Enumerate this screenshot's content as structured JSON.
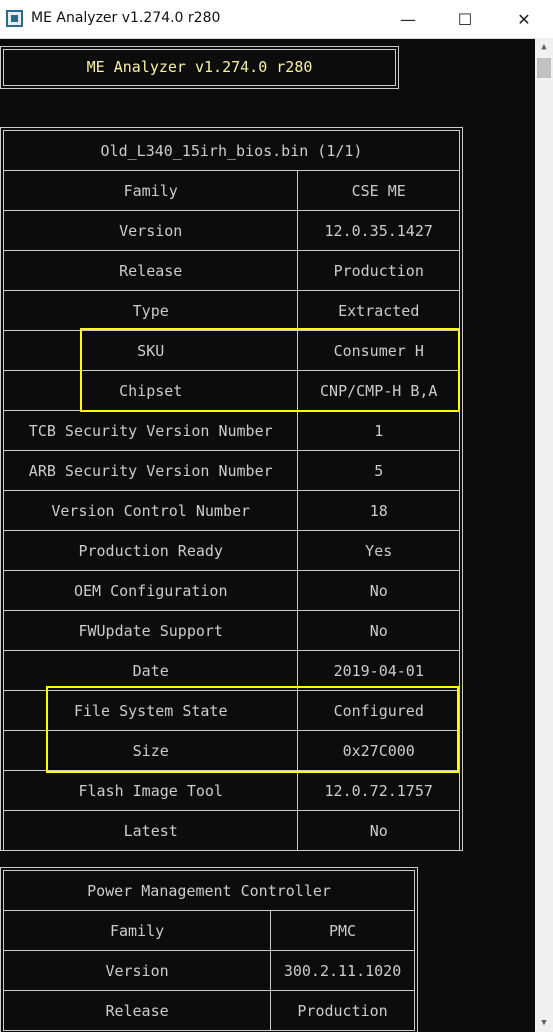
{
  "window": {
    "title": "ME Analyzer v1.274.0 r280",
    "app_icon": "app-icon",
    "controls": {
      "minimize": "—",
      "maximize": "☐",
      "close": "✕"
    }
  },
  "header": {
    "text": "ME Analyzer v1.274.0 r280"
  },
  "me_table": {
    "caption": "Old_L340_15irh_bios.bin (1/1)",
    "rows": [
      {
        "label": "Family",
        "value": "CSE ME"
      },
      {
        "label": "Version",
        "value": "12.0.35.1427"
      },
      {
        "label": "Release",
        "value": "Production"
      },
      {
        "label": "Type",
        "value": "Extracted"
      },
      {
        "label": "SKU",
        "value": "Consumer H"
      },
      {
        "label": "Chipset",
        "value": "CNP/CMP-H B,A"
      },
      {
        "label": "TCB Security Version Number",
        "value": "1"
      },
      {
        "label": "ARB Security Version Number",
        "value": "5"
      },
      {
        "label": "Version Control Number",
        "value": "18"
      },
      {
        "label": "Production Ready",
        "value": "Yes"
      },
      {
        "label": "OEM Configuration",
        "value": "No"
      },
      {
        "label": "FWUpdate Support",
        "value": "No"
      },
      {
        "label": "Date",
        "value": "2019-04-01"
      },
      {
        "label": "File System State",
        "value": "Configured"
      },
      {
        "label": "Size",
        "value": "0x27C000"
      },
      {
        "label": "Flash Image Tool",
        "value": "12.0.72.1757"
      },
      {
        "label": "Latest",
        "value": "No"
      }
    ]
  },
  "pmc_table": {
    "caption": "Power Management Controller",
    "rows": [
      {
        "label": "Family",
        "value": "PMC"
      },
      {
        "label": "Version",
        "value": "300.2.11.1020"
      },
      {
        "label": "Release",
        "value": "Production"
      }
    ]
  },
  "colors": {
    "console_bg": "#0c0c0c",
    "text": "#cccccc",
    "header_text": "#f9f1a5",
    "caption_text": "#61d6d6",
    "latest_no": "#e74856",
    "highlight": "#ffff00"
  }
}
